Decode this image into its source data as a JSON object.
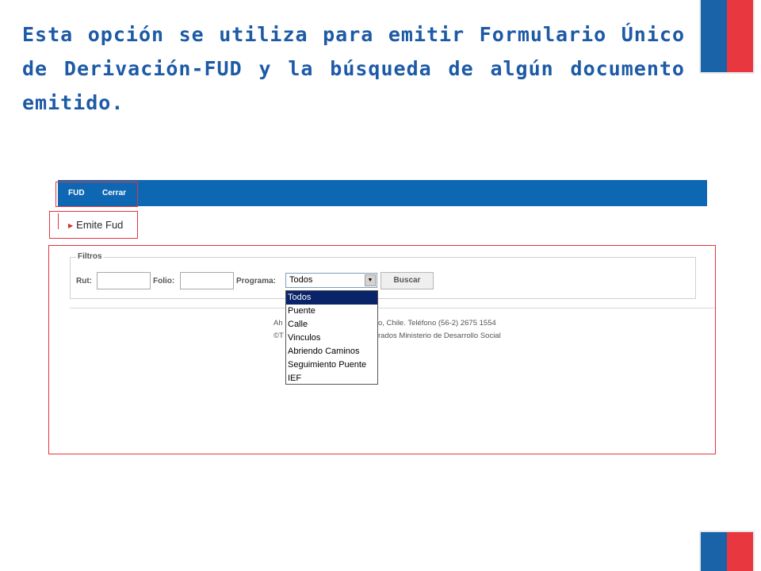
{
  "slide": {
    "title": "Esta opción se utiliza para emitir Formulario Único de Derivación-FUD y la búsqueda de algún documento emitido."
  },
  "nav": {
    "items": [
      "FUD",
      "Cerrar"
    ]
  },
  "submenu": {
    "emite": "Emite Fud"
  },
  "filters": {
    "legend": "Filtros",
    "rut_label": "Rut:",
    "rut_value": "",
    "folio_label": "Folio:",
    "folio_value": "",
    "programa_label": "Programa:",
    "programa_selected": "Todos",
    "buscar_label": "Buscar",
    "options": [
      "Todos",
      "Puente",
      "Calle",
      "Vinculos",
      "Abriendo Caminos",
      "Seguimiento Puente",
      "IEF"
    ]
  },
  "footer": {
    "line1_left": "Ah",
    "line1_right": "o, Chile. Teléfono (56-2) 2675 1554",
    "line2_left": "©T",
    "line2_right": "rados Ministerio de Desarrollo Social"
  },
  "colors": {
    "title": "#1d5aa6",
    "navbar": "#0e67b2",
    "highlight": "#e3363f",
    "flag_blue": "#1a63a8",
    "flag_red": "#e8373f"
  }
}
